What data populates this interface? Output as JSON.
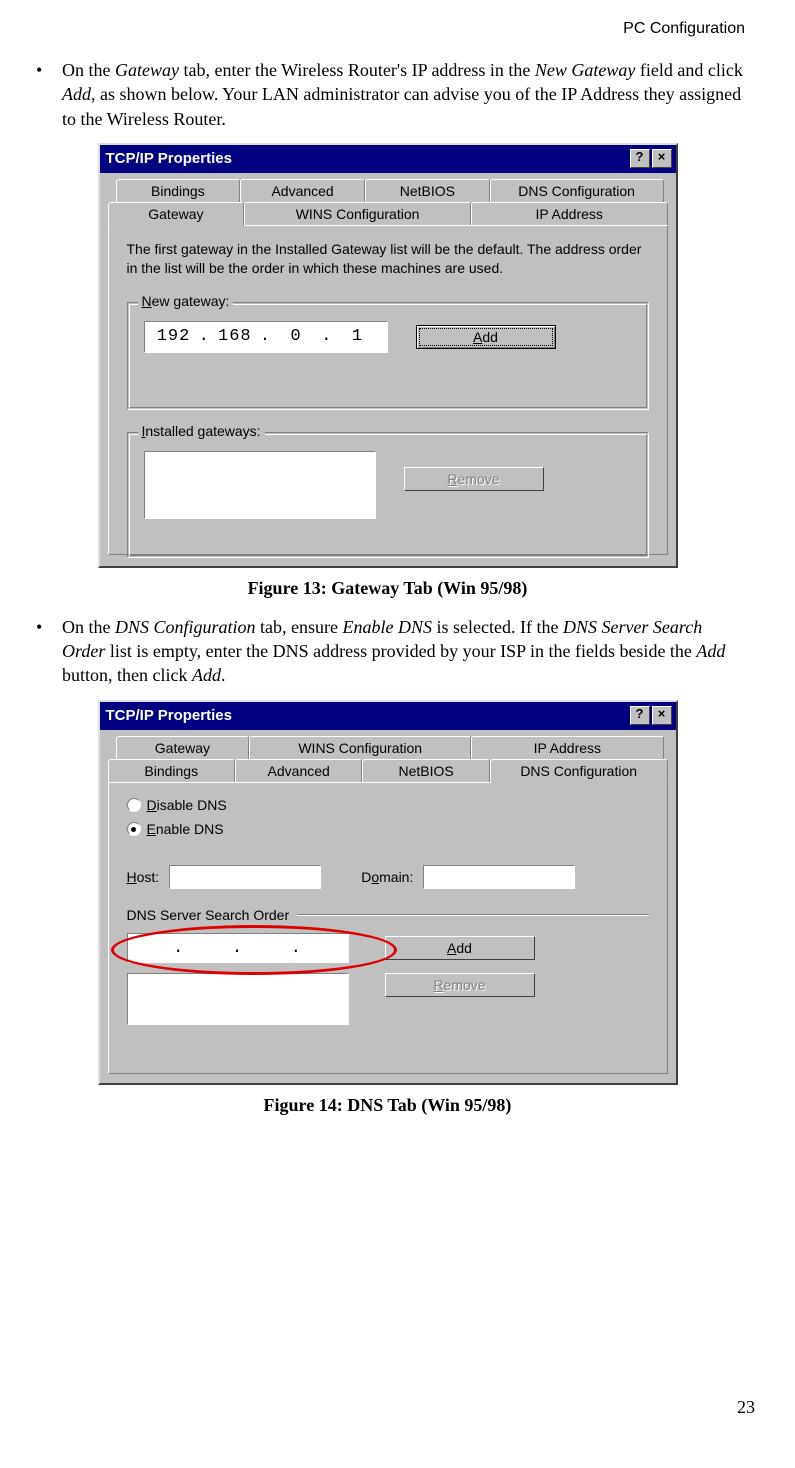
{
  "header": "PC Configuration",
  "page_number": "23",
  "bullet1": {
    "pre": "On the ",
    "i1": "Gateway",
    "mid1": " tab, enter the Wireless Router's IP address in the ",
    "i2": "New Gateway",
    "mid2": " field and click ",
    "i3": "Add",
    "post": ", as shown below. Your LAN administrator can advise you of the IP Address they assigned to the Wireless Router."
  },
  "bullet2": {
    "pre": "On the ",
    "i1": "DNS Configuration",
    "mid1": " tab, ensure ",
    "i2": "Enable DNS",
    "mid2": " is selected. If the ",
    "i3": "DNS Server Search Order",
    "mid3": " list is empty, enter the DNS address provided by your ISP in the fields beside the ",
    "i4": "Add",
    "post": " button, then click ",
    "i5": "Add",
    "end": "."
  },
  "caption1": "Figure 13: Gateway Tab (Win 95/98)",
  "caption2": "Figure 14: DNS Tab (Win 95/98)",
  "dlg": {
    "title": "TCP/IP Properties",
    "help": "?",
    "close": "×",
    "tabs_back": [
      "Bindings",
      "Advanced",
      "NetBIOS",
      "DNS Configuration"
    ],
    "tabs_front1": [
      "Gateway",
      "WINS Configuration",
      "IP Address"
    ],
    "desc1": "The first gateway in the Installed Gateway list will be the default. The address order in the list will be the order in which these machines are used.",
    "new_gateway_label": "New gateway:",
    "new_gateway_label_u": "N",
    "ip": {
      "a": "192",
      "b": "168",
      "c": "0",
      "d": "1"
    },
    "add_u": "A",
    "add_rest": "dd",
    "installed_label": "Installed gateways:",
    "installed_u": "I",
    "remove_u": "R",
    "remove_rest": "emove",
    "tabs_back2": [
      "Gateway",
      "WINS Configuration",
      "IP Address"
    ],
    "tabs_front2": [
      "Bindings",
      "Advanced",
      "NetBIOS",
      "DNS Configuration"
    ],
    "disable_dns": "Disable DNS",
    "disable_u": "D",
    "enable_dns": "Enable DNS",
    "enable_u": "E",
    "host": "Host:",
    "host_u": "H",
    "domain": "Domain:",
    "domain_u": "o",
    "search_order": "DNS Server Search Order"
  }
}
